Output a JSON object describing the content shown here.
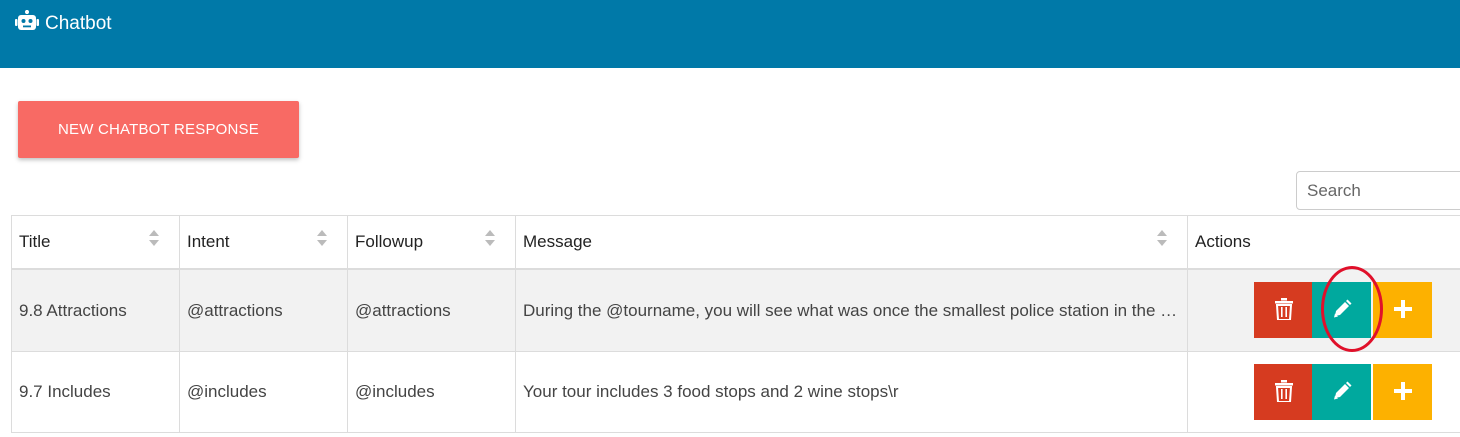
{
  "app": {
    "title": "Chatbot",
    "icon": "robot-icon"
  },
  "toolbar": {
    "new_label": "NEW CHATBOT RESPONSE"
  },
  "search": {
    "placeholder": "Search"
  },
  "table": {
    "headers": [
      "Title",
      "Intent",
      "Followup",
      "Message",
      "Actions"
    ],
    "rows": [
      {
        "title": "9.8 Attractions",
        "intent": "@attractions",
        "followup": "@attractions",
        "message": "During the @tourname, you will see what was once the smallest police station in the world"
      },
      {
        "title": "9.7 Includes",
        "intent": "@includes",
        "followup": "@includes",
        "message": "Your tour includes 3 food stops and 2 wine stops\\r"
      }
    ]
  },
  "actions": {
    "delete_icon": "trash-icon",
    "edit_icon": "pencil-icon",
    "add_icon": "plus-icon"
  },
  "colors": {
    "header_bar": "#0079a8",
    "new_button": "#f86a64",
    "delete": "#d63b20",
    "edit": "#00a99e",
    "add": "#fdb100",
    "highlight_circle": "#e0102a"
  }
}
